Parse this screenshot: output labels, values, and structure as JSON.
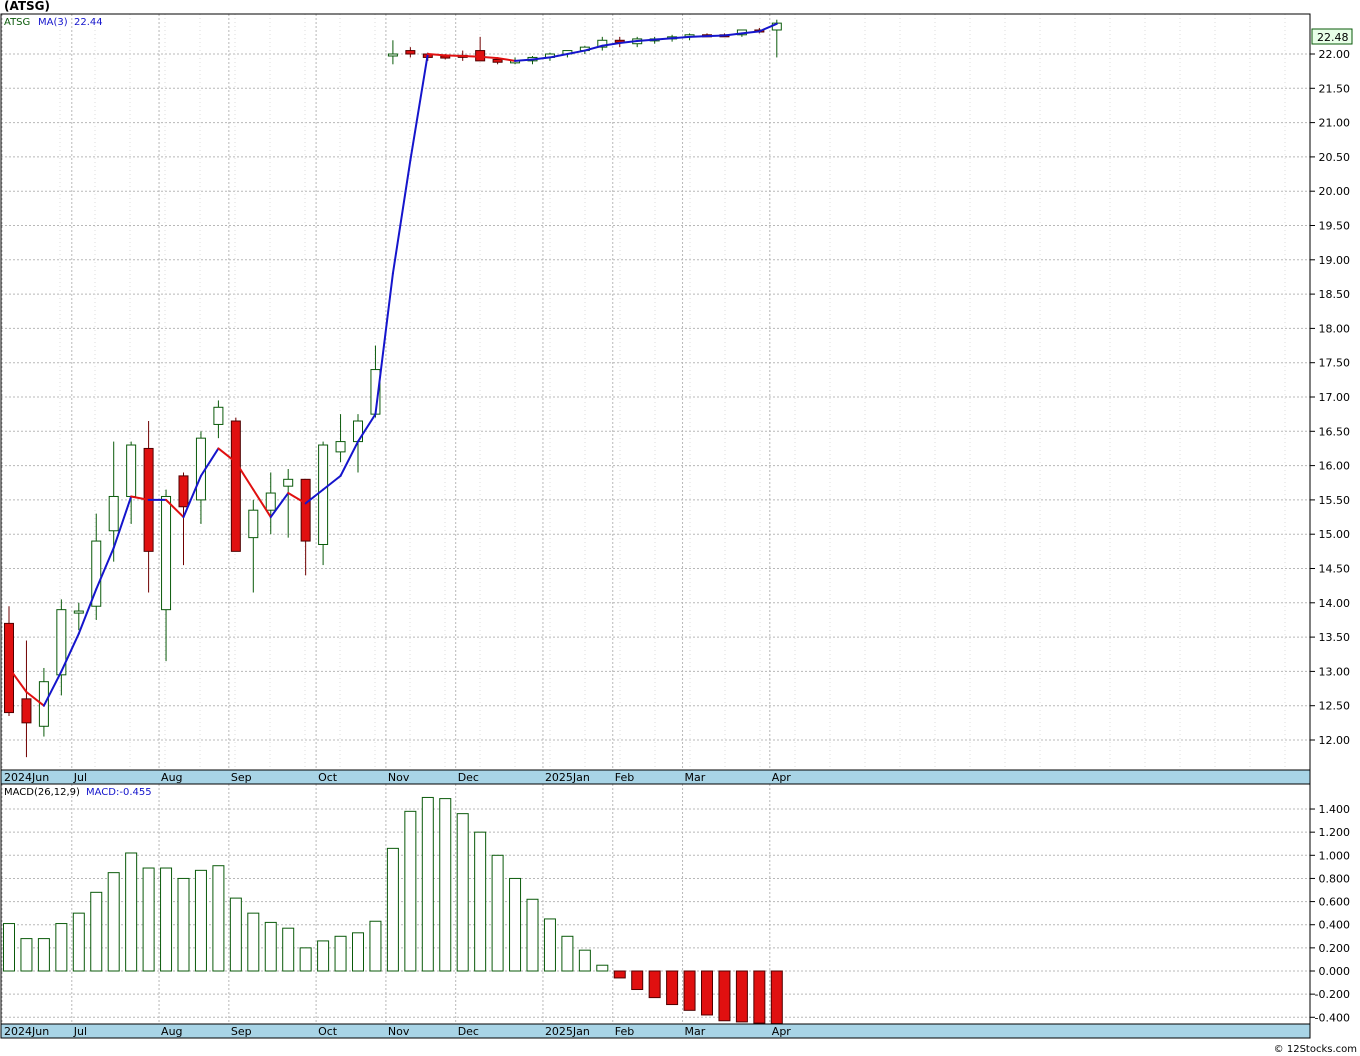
{
  "chart_data": [
    {
      "type": "candlestick",
      "title": "(ATSG)",
      "legend": {
        "symbol": "ATSG",
        "ma_label": "MA(3)",
        "ma_value": "22.44"
      },
      "last_price_label": "22.48",
      "ylim": [
        11.6,
        22.9
      ],
      "y_ticks": [
        "12.00",
        "12.50",
        "13.00",
        "13.50",
        "14.00",
        "14.50",
        "15.00",
        "15.50",
        "16.00",
        "16.50",
        "17.00",
        "17.50",
        "18.00",
        "18.50",
        "19.00",
        "19.50",
        "20.00",
        "20.50",
        "21.00",
        "21.50",
        "22.00"
      ],
      "x_labels": [
        "2024Jun",
        "Jul",
        "Aug",
        "Sep",
        "Oct",
        "Nov",
        "Dec",
        "2025Jan",
        "Feb",
        "Mar",
        "Apr"
      ],
      "x_label_index": [
        0,
        4,
        9,
        13,
        18,
        22,
        26,
        31,
        35,
        39,
        44
      ],
      "grid": true,
      "candles": [
        {
          "o": 13.7,
          "h": 13.95,
          "l": 12.35,
          "c": 12.4
        },
        {
          "o": 12.6,
          "h": 13.45,
          "l": 11.75,
          "c": 12.25
        },
        {
          "o": 12.2,
          "h": 13.05,
          "l": 12.05,
          "c": 12.85
        },
        {
          "o": 12.95,
          "h": 14.05,
          "l": 12.65,
          "c": 13.9
        },
        {
          "o": 13.85,
          "h": 14.0,
          "l": 13.6,
          "c": 13.88
        },
        {
          "o": 13.95,
          "h": 15.3,
          "l": 13.75,
          "c": 14.9
        },
        {
          "o": 15.05,
          "h": 16.35,
          "l": 14.6,
          "c": 15.55
        },
        {
          "o": 15.55,
          "h": 16.35,
          "l": 15.15,
          "c": 16.3
        },
        {
          "o": 16.25,
          "h": 16.65,
          "l": 14.15,
          "c": 14.75
        },
        {
          "o": 13.9,
          "h": 15.65,
          "l": 13.15,
          "c": 15.55
        },
        {
          "o": 15.85,
          "h": 15.9,
          "l": 14.55,
          "c": 15.4
        },
        {
          "o": 15.5,
          "h": 16.5,
          "l": 15.15,
          "c": 16.4
        },
        {
          "o": 16.6,
          "h": 16.95,
          "l": 16.4,
          "c": 16.85
        },
        {
          "o": 16.65,
          "h": 16.7,
          "l": 14.75,
          "c": 14.75
        },
        {
          "o": 14.95,
          "h": 15.5,
          "l": 14.15,
          "c": 15.35
        },
        {
          "o": 15.35,
          "h": 15.9,
          "l": 15.0,
          "c": 15.6
        },
        {
          "o": 15.7,
          "h": 15.95,
          "l": 14.95,
          "c": 15.8
        },
        {
          "o": 15.8,
          "h": 15.8,
          "l": 14.4,
          "c": 14.9
        },
        {
          "o": 14.85,
          "h": 16.35,
          "l": 14.55,
          "c": 16.3
        },
        {
          "o": 16.2,
          "h": 16.75,
          "l": 16.05,
          "c": 16.35
        },
        {
          "o": 16.35,
          "h": 16.75,
          "l": 15.9,
          "c": 16.65
        },
        {
          "o": 16.75,
          "h": 17.75,
          "l": 16.7,
          "c": 17.4
        },
        {
          "o": 22.0,
          "h": 22.2,
          "l": 21.85,
          "c": 22.0
        },
        {
          "o": 22.05,
          "h": 22.1,
          "l": 21.95,
          "c": 22.0
        },
        {
          "o": 22.0,
          "h": 22.02,
          "l": 21.9,
          "c": 21.95
        },
        {
          "o": 21.97,
          "h": 22.0,
          "l": 21.92,
          "c": 21.95
        },
        {
          "o": 21.98,
          "h": 22.05,
          "l": 21.9,
          "c": 21.97
        },
        {
          "o": 22.05,
          "h": 22.25,
          "l": 21.9,
          "c": 21.9
        },
        {
          "o": 21.92,
          "h": 21.95,
          "l": 21.85,
          "c": 21.88
        },
        {
          "o": 21.88,
          "h": 21.95,
          "l": 21.85,
          "c": 21.9
        },
        {
          "o": 21.9,
          "h": 21.97,
          "l": 21.85,
          "c": 21.95
        },
        {
          "o": 21.95,
          "h": 22.02,
          "l": 21.9,
          "c": 22.0
        },
        {
          "o": 22.0,
          "h": 22.05,
          "l": 21.95,
          "c": 22.05
        },
        {
          "o": 22.05,
          "h": 22.12,
          "l": 22.0,
          "c": 22.1
        },
        {
          "o": 22.1,
          "h": 22.25,
          "l": 22.05,
          "c": 22.2
        },
        {
          "o": 22.2,
          "h": 22.25,
          "l": 22.1,
          "c": 22.18
        },
        {
          "o": 22.15,
          "h": 22.25,
          "l": 22.1,
          "c": 22.22
        },
        {
          "o": 22.2,
          "h": 22.25,
          "l": 22.15,
          "c": 22.22
        },
        {
          "o": 22.22,
          "h": 22.28,
          "l": 22.18,
          "c": 22.25
        },
        {
          "o": 22.25,
          "h": 22.3,
          "l": 22.2,
          "c": 22.28
        },
        {
          "o": 22.28,
          "h": 22.3,
          "l": 22.25,
          "c": 22.27
        },
        {
          "o": 22.28,
          "h": 22.3,
          "l": 22.25,
          "c": 22.26
        },
        {
          "o": 22.28,
          "h": 22.35,
          "l": 22.25,
          "c": 22.35
        },
        {
          "o": 22.35,
          "h": 22.38,
          "l": 22.3,
          "c": 22.33
        },
        {
          "o": 22.35,
          "h": 22.5,
          "l": 21.95,
          "c": 22.45
        }
      ],
      "ma": {
        "name": "MA(3)",
        "values": [
          13.05,
          12.7,
          12.5,
          13.0,
          13.55,
          14.2,
          14.8,
          15.55,
          15.5,
          15.5,
          15.25,
          15.85,
          16.25,
          16.05,
          15.65,
          15.25,
          15.6,
          15.45,
          15.65,
          15.85,
          16.35,
          16.75,
          18.8,
          20.45,
          22.0,
          21.98,
          21.97,
          21.96,
          21.94,
          21.9,
          21.92,
          21.95,
          22.0,
          22.05,
          22.12,
          22.16,
          22.19,
          22.21,
          22.23,
          22.25,
          22.26,
          22.27,
          22.3,
          22.33,
          22.44
        ],
        "color_up": "#1515cc",
        "color_down": "#e01010"
      }
    },
    {
      "type": "bar",
      "legend": {
        "label": "MACD(26,12,9)",
        "value_label": "MACD:-0.455"
      },
      "ylim": [
        -0.47,
        1.58
      ],
      "y_ticks": [
        "1.400",
        "1.200",
        "1.000",
        "0.800",
        "0.600",
        "0.400",
        "0.200",
        "0.000",
        "-0.200",
        "-0.400"
      ],
      "x_labels": [
        "2024Jun",
        "Jul",
        "Aug",
        "Sep",
        "Oct",
        "Nov",
        "Dec",
        "2025Jan",
        "Feb",
        "Mar",
        "Apr"
      ],
      "values": [
        0.41,
        0.28,
        0.28,
        0.41,
        0.5,
        0.68,
        0.85,
        1.02,
        0.89,
        0.89,
        0.8,
        0.87,
        0.91,
        0.63,
        0.5,
        0.42,
        0.37,
        0.2,
        0.26,
        0.3,
        0.33,
        0.43,
        1.06,
        1.38,
        1.5,
        1.49,
        1.36,
        1.2,
        1.0,
        0.8,
        0.62,
        0.45,
        0.3,
        0.18,
        0.05,
        -0.06,
        -0.16,
        -0.23,
        -0.29,
        -0.34,
        -0.38,
        -0.43,
        -0.44,
        -0.45,
        -0.455
      ]
    }
  ],
  "colors": {
    "up_outline": "#0a5a0a",
    "down_fill": "#e01010",
    "axis_strip": "#a8d4e6",
    "grid": "#b8b8b8",
    "price_tag": "#e8ffe8"
  },
  "footer": "© 12Stocks.com"
}
